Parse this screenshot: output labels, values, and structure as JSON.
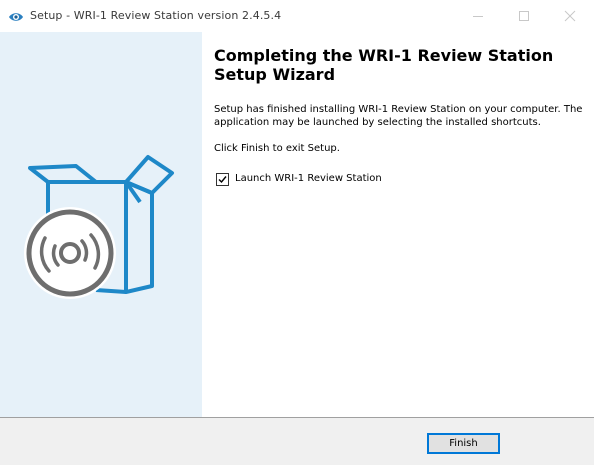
{
  "window": {
    "title": "Setup - WRI-1 Review Station version 2.4.5.4",
    "app_icon": "eye-icon",
    "controls": [
      "minimize-icon",
      "maximize-icon",
      "close-icon"
    ]
  },
  "banner": {
    "illustration": "software-box-with-disc-icon",
    "background_color": "#e6f1f9",
    "box_color": "#1e88c8",
    "disc_color": "#6e6e6e"
  },
  "content": {
    "heading": "Completing the WRI-1 Review Station Setup Wizard",
    "message": "Setup has finished installing WRI-1 Review Station on your computer. The application may be launched by selecting the installed shortcuts.",
    "exit_hint": "Click Finish to exit Setup.",
    "launch_checkbox": {
      "label": "Launch WRI-1 Review Station",
      "checked": true
    }
  },
  "footer": {
    "finish_label": "Finish"
  }
}
